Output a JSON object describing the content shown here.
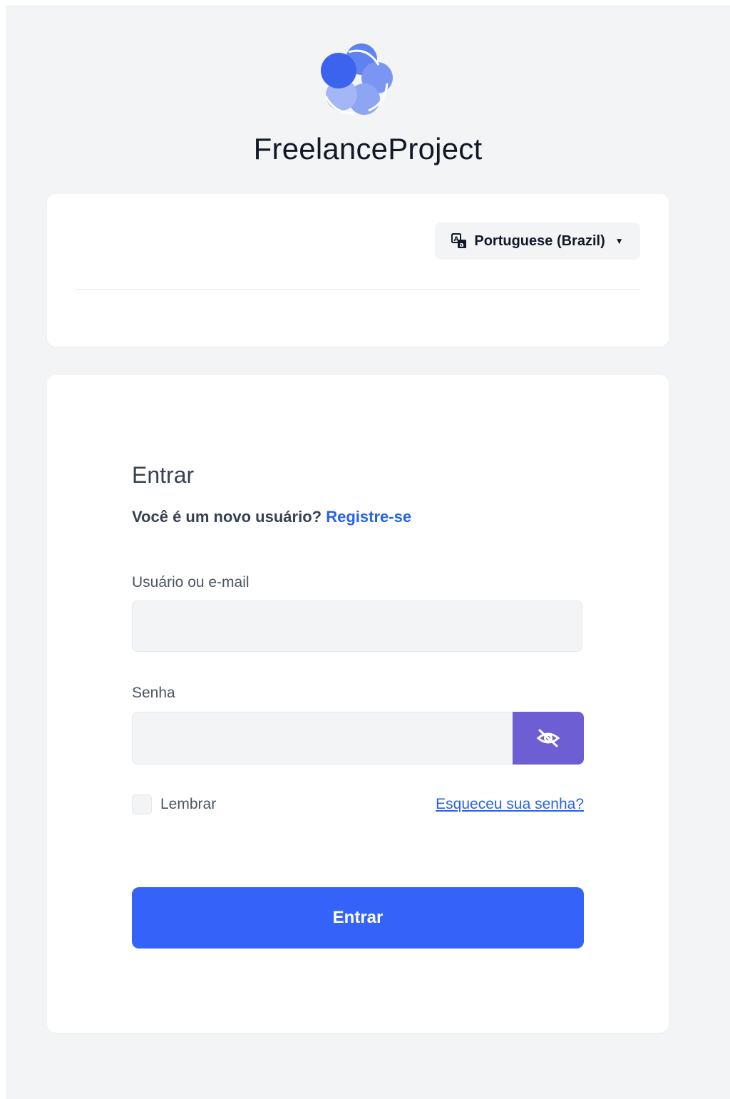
{
  "brand": {
    "name": "FreelanceProject",
    "logo_icon": "flower-logo-icon"
  },
  "colors": {
    "primary": "#3563fa",
    "eye_button": "#6d5fd3",
    "link": "#2563eb",
    "background": "#f3f4f6"
  },
  "language": {
    "selected": "Portuguese (Brazil)",
    "icon": "translate-icon"
  },
  "login": {
    "title": "Entrar",
    "register_prompt": "Você é um novo usuário?",
    "register_link": "Registre-se",
    "username_label": "Usuário ou e-mail",
    "username_value": "",
    "password_label": "Senha",
    "password_value": "",
    "toggle_icon": "eye-off-icon",
    "remember_label": "Lembrar",
    "remember_checked": false,
    "forgot_link": "Esqueceu sua senha?",
    "submit_label": "Entrar"
  }
}
